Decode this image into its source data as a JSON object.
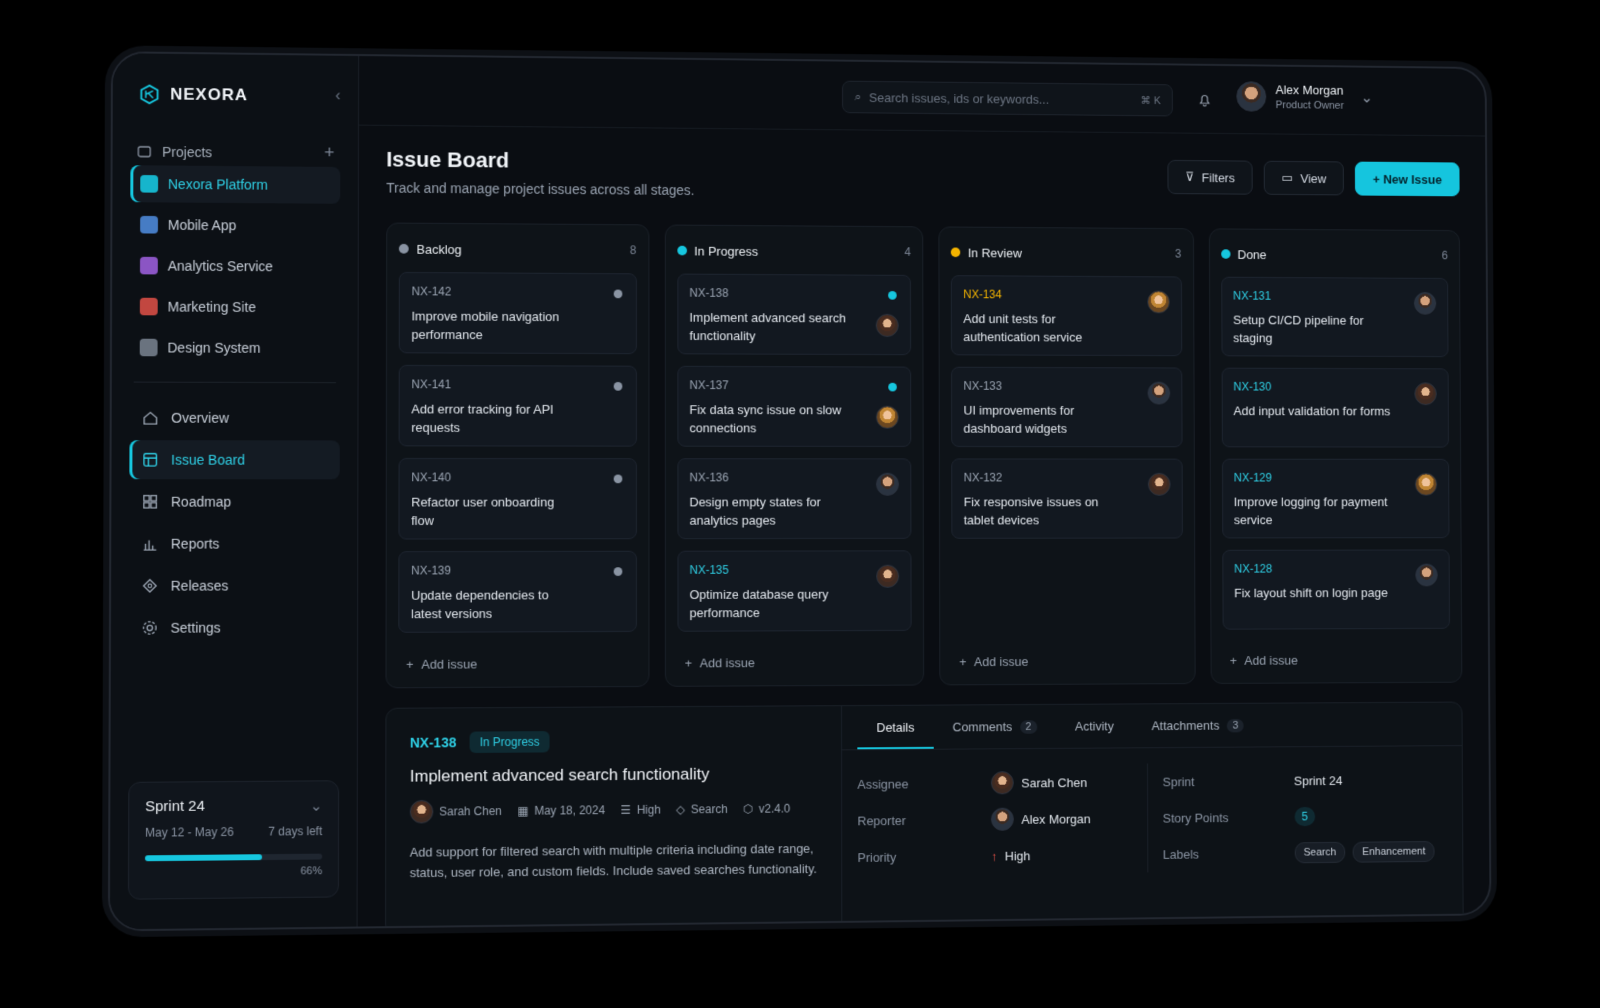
{
  "app": {
    "brand": "NEXORA"
  },
  "sidebar": {
    "projects_label": "Projects",
    "projects": [
      {
        "label": "Nexora Platform",
        "color": "#16c7df",
        "active": true
      },
      {
        "label": "Mobile App",
        "color": "#5aa0ff"
      },
      {
        "label": "Analytics Service",
        "color": "#b56cff"
      },
      {
        "label": "Marketing Site",
        "color": "#ff5a4f"
      },
      {
        "label": "Design System",
        "color": "#8a94a3"
      }
    ],
    "nav": [
      {
        "label": "Overview",
        "icon": "home-icon"
      },
      {
        "label": "Issue Board",
        "icon": "board-icon",
        "active": true
      },
      {
        "label": "Roadmap",
        "icon": "roadmap-icon"
      },
      {
        "label": "Reports",
        "icon": "chart-icon"
      },
      {
        "label": "Releases",
        "icon": "tag-icon"
      },
      {
        "label": "Settings",
        "icon": "gear-icon"
      }
    ],
    "sprint": {
      "name": "Sprint 24",
      "dates": "May 12 - May 26",
      "left": "7 days left",
      "progress": 0.66,
      "progress_label": "66%"
    }
  },
  "topbar": {
    "search_placeholder": "Search issues, ids or keywords...",
    "shortcut": "⌘ K",
    "user": {
      "name": "Alex Morgan",
      "role": "Product Owner"
    }
  },
  "page": {
    "title": "Issue Board",
    "subtitle": "Track and manage project issues across all stages.",
    "filters": "Filters",
    "view": "View",
    "new_issue": "+ New Issue"
  },
  "board": {
    "add_issue": "Add issue",
    "columns": [
      {
        "name": "Backlog",
        "count": "8",
        "color": "#8a94a3",
        "cards": [
          {
            "id": "NX-142",
            "title": "Improve mobile navigation performance"
          },
          {
            "id": "NX-141",
            "title": "Add error tracking for API requests"
          },
          {
            "id": "NX-140",
            "title": "Refactor user onboarding flow"
          },
          {
            "id": "NX-139",
            "title": "Update dependencies to latest versions"
          }
        ]
      },
      {
        "name": "In Progress",
        "count": "4",
        "color": "#16c7df",
        "cards": [
          {
            "id": "NX-138",
            "title": "Implement advanced search functionality"
          },
          {
            "id": "NX-137",
            "title": "Fix data sync issue on slow connections"
          },
          {
            "id": "NX-136",
            "title": "Design empty states for analytics pages"
          },
          {
            "id": "NX-135",
            "title": "Optimize database query performance"
          }
        ]
      },
      {
        "name": "In Review",
        "count": "3",
        "color": "#f4b400",
        "cards": [
          {
            "id": "NX-134",
            "title": "Add unit tests for authentication service"
          },
          {
            "id": "NX-133",
            "title": "UI improvements for dashboard widgets"
          },
          {
            "id": "NX-132",
            "title": "Fix responsive issues on tablet devices"
          }
        ]
      },
      {
        "name": "Done",
        "count": "6",
        "color": "#16c7df",
        "cards": [
          {
            "id": "NX-131",
            "title": "Setup CI/CD pipeline for staging"
          },
          {
            "id": "NX-130",
            "title": "Add input validation for forms"
          },
          {
            "id": "NX-129",
            "title": "Improve logging for payment service"
          },
          {
            "id": "NX-128",
            "title": "Fix layout shift on login page"
          }
        ]
      }
    ]
  },
  "detail": {
    "id": "NX-138",
    "status": "In Progress",
    "title": "Implement advanced search functionality",
    "assignee_meta": "Sarah Chen",
    "date": "May 18, 2024",
    "priority_meta": "High",
    "component": "Search",
    "version": "v2.4.0",
    "description": "Add support for filtered search with multiple criteria including date range, status, user role, and custom fields. Include saved searches functionality.",
    "tabs": [
      {
        "label": "Details",
        "count": ""
      },
      {
        "label": "Comments",
        "count": "2"
      },
      {
        "label": "Activity",
        "count": ""
      },
      {
        "label": "Attachments",
        "count": "3"
      }
    ],
    "props": {
      "assignee_k": "Assignee",
      "assignee_v": "Sarah Chen",
      "reporter_k": "Reporter",
      "reporter_v": "Alex Morgan",
      "priority_k": "Priority",
      "priority_v": "High",
      "sprint_k": "Sprint",
      "sprint_v": "Sprint 24",
      "points_k": "Story Points",
      "points_v": "5",
      "labels_k": "Labels",
      "label1": "Search",
      "label2": "Enhancement"
    }
  }
}
